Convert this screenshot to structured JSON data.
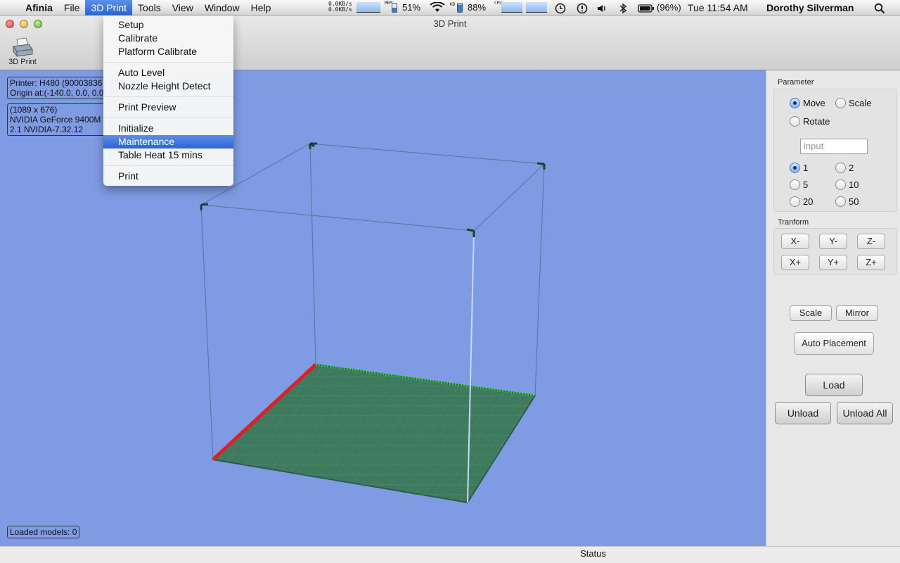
{
  "menubar": {
    "apple": "",
    "app": "Afinia",
    "items": [
      "File",
      "3D Print",
      "Tools",
      "View",
      "Window",
      "Help"
    ],
    "net_up": "0.0KB/s",
    "net_down": "0.0KB/s",
    "mem_label": "MEM",
    "mem_value": "51%",
    "hd_label": "HD",
    "hd_value": "88%",
    "cpu_label": "CPU",
    "battery": "(96%)",
    "clock": "Tue 11:54 AM",
    "user": "Dorothy Silverman"
  },
  "window": {
    "title": "3D Print",
    "toolbar_label": "3D Print"
  },
  "menu": {
    "items": [
      "Setup",
      "Calibrate",
      "Platform Calibrate",
      "Auto Level",
      "Nozzle Height Detect",
      "Print Preview",
      "Initialize",
      "Maintenance",
      "Table Heat 15 mins",
      "Print"
    ],
    "highlighted": "Maintenance"
  },
  "viewport": {
    "printer_line1": "Printer: H480 (90003836",
    "printer_line2": "Origin at:(-140.0, 0.0, 0.0",
    "gl_line1": "(1089 x 676)",
    "gl_line2": "NVIDIA GeForce 9400M",
    "gl_line3": "2.1 NVIDIA-7.32.12",
    "loaded_models": "Loaded models: 0"
  },
  "panel": {
    "parameter_label": "Parameter",
    "move": "Move",
    "scale": "Scale",
    "rotate": "Rotate",
    "input_placeholder": "input",
    "steps": [
      "1",
      "2",
      "5",
      "10",
      "20",
      "50"
    ],
    "selected_mode": "Move",
    "selected_step": "1",
    "transform_label": "Tranform",
    "xm": "X-",
    "ym": "Y-",
    "zm": "Z-",
    "xp": "X+",
    "yp": "Y+",
    "zp": "Z+",
    "scale_btn": "Scale",
    "mirror_btn": "Mirror",
    "auto_placement": "Auto Placement",
    "load": "Load",
    "unload": "Unload",
    "unload_all": "Unload All"
  },
  "status": {
    "text": "Status"
  },
  "colors": {
    "viewport_bg": "#7e9be3",
    "platform": "#3d7a5e",
    "x_axis": "#e02020",
    "y_axis": "#30d030"
  }
}
